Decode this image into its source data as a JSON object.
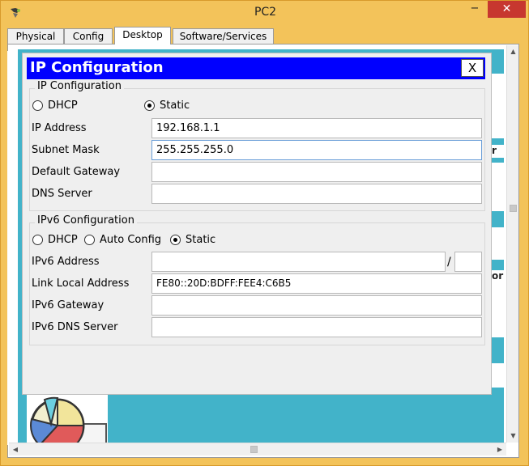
{
  "window": {
    "title": "PC2",
    "minimize_label": "−",
    "maximize_label": "□",
    "close_label": "✕"
  },
  "tabs": [
    {
      "label": "Physical"
    },
    {
      "label": "Config"
    },
    {
      "label": "Desktop",
      "active": true
    },
    {
      "label": "Software/Services"
    }
  ],
  "desktop_fragments": {
    "text_r": "r",
    "text_or": "or"
  },
  "dialog": {
    "title": "IP Configuration",
    "close_label": "X",
    "ipv4": {
      "group_title": "IP Configuration",
      "mode": "Static",
      "options": [
        "DHCP",
        "Static"
      ],
      "fields": [
        {
          "label": "IP Address",
          "value": "192.168.1.1"
        },
        {
          "label": "Subnet Mask",
          "value": "255.255.255.0"
        },
        {
          "label": "Default Gateway",
          "value": ""
        },
        {
          "label": "DNS Server",
          "value": ""
        }
      ]
    },
    "ipv6": {
      "group_title": "IPv6 Configuration",
      "mode": "Static",
      "options": [
        "DHCP",
        "Auto Config",
        "Static"
      ],
      "address_label": "IPv6 Address",
      "address_value": "",
      "prefix_separator": "/",
      "prefix_value": "",
      "fields": [
        {
          "label": "Link Local Address",
          "value": "FE80::20D:BDFF:FEE4:C6B5"
        },
        {
          "label": "IPv6 Gateway",
          "value": ""
        },
        {
          "label": "IPv6 DNS Server",
          "value": ""
        }
      ]
    }
  },
  "colors": {
    "window_frame": "#f3c35a",
    "dialog_header": "#0000ff",
    "desktop_bg": "#42b3c9"
  }
}
